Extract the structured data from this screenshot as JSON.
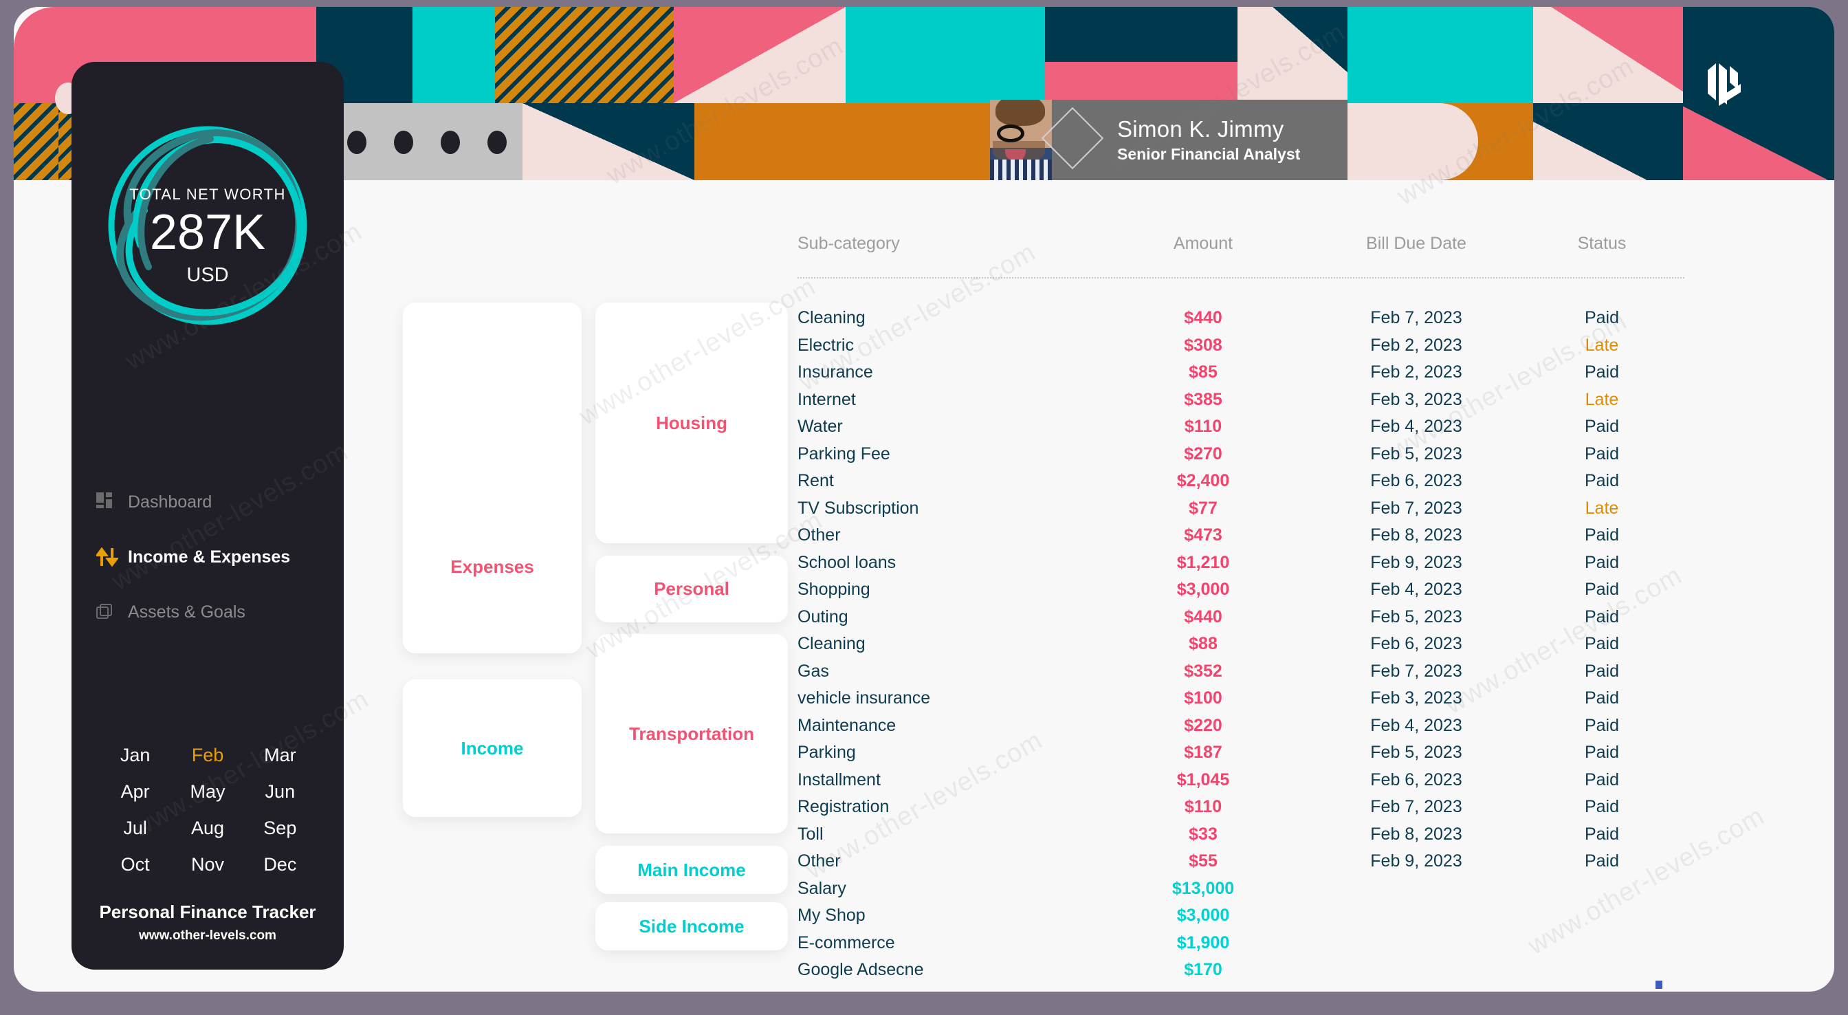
{
  "window": {
    "traffic_lights": [
      "close",
      "minimize",
      "zoom",
      "extra"
    ]
  },
  "header": {
    "profile_name": "Simon K. Jimmy",
    "profile_role": "Senior Financial Analyst",
    "logo": "dl-monogram-logo"
  },
  "sidebar": {
    "networth": {
      "label": "TOTAL NET WORTH",
      "value": "287K",
      "currency": "USD"
    },
    "nav": [
      {
        "label": "Dashboard",
        "icon": "dashboard-icon",
        "active": false
      },
      {
        "label": "Income & Expenses",
        "icon": "up-down-arrows-icon",
        "active": true
      },
      {
        "label": "Assets & Goals",
        "icon": "layers-icon",
        "active": false
      }
    ],
    "months": [
      {
        "label": "Jan",
        "active": false
      },
      {
        "label": "Feb",
        "active": true
      },
      {
        "label": "Mar",
        "active": false
      },
      {
        "label": "Apr",
        "active": false
      },
      {
        "label": "May",
        "active": false
      },
      {
        "label": "Jun",
        "active": false
      },
      {
        "label": "Jul",
        "active": false
      },
      {
        "label": "Aug",
        "active": false
      },
      {
        "label": "Sep",
        "active": false
      },
      {
        "label": "Oct",
        "active": false
      },
      {
        "label": "Nov",
        "active": false
      },
      {
        "label": "Dec",
        "active": false
      }
    ],
    "footer": {
      "title": "Personal Finance Tracker",
      "url": "www.other-levels.com"
    }
  },
  "categories": {
    "expenses_label": "Expenses",
    "income_label": "Income",
    "sub": [
      {
        "label": "Housing",
        "type": "expense"
      },
      {
        "label": "Personal",
        "type": "expense"
      },
      {
        "label": "Transportation",
        "type": "expense"
      },
      {
        "label": "Main Income",
        "type": "income"
      },
      {
        "label": "Side Income",
        "type": "income"
      }
    ]
  },
  "table": {
    "columns": [
      "Sub-category",
      "Amount",
      "Bill Due Date",
      "Status"
    ],
    "rows": [
      {
        "sub": "Cleaning",
        "amount": "$440",
        "date": "Feb 7, 2023",
        "status": "Paid",
        "kind": "expense"
      },
      {
        "sub": "Electric",
        "amount": "$308",
        "date": "Feb 2, 2023",
        "status": "Late",
        "kind": "expense"
      },
      {
        "sub": "Insurance",
        "amount": "$85",
        "date": "Feb 2, 2023",
        "status": "Paid",
        "kind": "expense"
      },
      {
        "sub": "Internet",
        "amount": "$385",
        "date": "Feb 3, 2023",
        "status": "Late",
        "kind": "expense"
      },
      {
        "sub": "Water",
        "amount": "$110",
        "date": "Feb 4, 2023",
        "status": "Paid",
        "kind": "expense"
      },
      {
        "sub": "Parking Fee",
        "amount": "$270",
        "date": "Feb 5, 2023",
        "status": "Paid",
        "kind": "expense"
      },
      {
        "sub": "Rent",
        "amount": "$2,400",
        "date": "Feb 6, 2023",
        "status": "Paid",
        "kind": "expense"
      },
      {
        "sub": "TV Subscription",
        "amount": "$77",
        "date": "Feb 7, 2023",
        "status": "Late",
        "kind": "expense"
      },
      {
        "sub": "Other",
        "amount": "$473",
        "date": "Feb 8, 2023",
        "status": "Paid",
        "kind": "expense"
      },
      {
        "sub": "School loans",
        "amount": "$1,210",
        "date": "Feb 9, 2023",
        "status": "Paid",
        "kind": "expense"
      },
      {
        "sub": "Shopping",
        "amount": "$3,000",
        "date": "Feb 4, 2023",
        "status": "Paid",
        "kind": "expense"
      },
      {
        "sub": "Outing",
        "amount": "$440",
        "date": "Feb 5, 2023",
        "status": "Paid",
        "kind": "expense"
      },
      {
        "sub": "Cleaning",
        "amount": "$88",
        "date": "Feb 6, 2023",
        "status": "Paid",
        "kind": "expense"
      },
      {
        "sub": "Gas",
        "amount": "$352",
        "date": "Feb 7, 2023",
        "status": "Paid",
        "kind": "expense"
      },
      {
        "sub": "vehicle insurance",
        "amount": "$100",
        "date": "Feb 3, 2023",
        "status": "Paid",
        "kind": "expense"
      },
      {
        "sub": "Maintenance",
        "amount": "$220",
        "date": "Feb 4, 2023",
        "status": "Paid",
        "kind": "expense"
      },
      {
        "sub": "Parking",
        "amount": "$187",
        "date": "Feb 5, 2023",
        "status": "Paid",
        "kind": "expense"
      },
      {
        "sub": "Installment",
        "amount": "$1,045",
        "date": "Feb 6, 2023",
        "status": "Paid",
        "kind": "expense"
      },
      {
        "sub": "Registration",
        "amount": "$110",
        "date": "Feb 7, 2023",
        "status": "Paid",
        "kind": "expense"
      },
      {
        "sub": "Toll",
        "amount": "$33",
        "date": "Feb 8, 2023",
        "status": "Paid",
        "kind": "expense"
      },
      {
        "sub": "Other",
        "amount": "$55",
        "date": "Feb 9, 2023",
        "status": "Paid",
        "kind": "expense"
      },
      {
        "sub": "Salary",
        "amount": "$13,000",
        "date": "",
        "status": "",
        "kind": "income"
      },
      {
        "sub": "My Shop",
        "amount": "$3,000",
        "date": "",
        "status": "",
        "kind": "income"
      },
      {
        "sub": "E-commerce",
        "amount": "$1,900",
        "date": "",
        "status": "",
        "kind": "income"
      },
      {
        "sub": "Google Adsecne",
        "amount": "$170",
        "date": "",
        "status": "",
        "kind": "income"
      }
    ]
  },
  "watermark": "www.other-levels.com",
  "colors": {
    "pink": "#f4436c",
    "teal": "#00d2d2",
    "dark_navy": "#0d3b4f",
    "orange": "#e08c00",
    "sidebar_bg": "#201e26",
    "window_bg": "#f8f8f8"
  }
}
